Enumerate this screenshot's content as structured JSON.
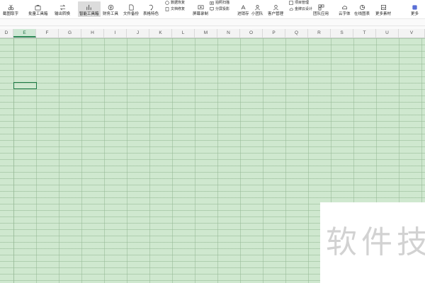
{
  "ribbon": {
    "items": [
      {
        "label": "截图取字",
        "icon": "scissors-icon"
      },
      {
        "label": "批量工具箱",
        "icon": "toolbox-icon"
      },
      {
        "label": "输出转换",
        "icon": "convert-icon"
      },
      {
        "label": "智能工具箱",
        "icon": "smart-toolbox-icon",
        "active": true
      },
      {
        "label": "财务工具",
        "icon": "finance-icon"
      },
      {
        "label": "文件备份",
        "icon": "backup-icon"
      },
      {
        "label": "表格特色",
        "icon": "table-feature-icon"
      },
      {
        "label": "文档修复",
        "icon": "doc-repair-icon"
      },
      {
        "label": "屏幕录制",
        "icon": "screen-record-icon"
      },
      {
        "label": "进销存",
        "icon": "inventory-icon"
      },
      {
        "label": "小团队",
        "icon": "team-icon"
      },
      {
        "label": "客户管理",
        "icon": "customer-icon"
      },
      {
        "label": "团队应用",
        "icon": "team-app-icon"
      },
      {
        "label": "云字体",
        "icon": "cloud-font-icon"
      },
      {
        "label": "在线图表",
        "icon": "online-chart-icon"
      },
      {
        "label": "更多素材",
        "icon": "more-material-icon"
      },
      {
        "label": "更多",
        "icon": "more-icon"
      }
    ],
    "stack1": [
      "数据恢复",
      "文档修复"
    ],
    "stack2": [
      "拍照扫描",
      "分屏投影"
    ],
    "stack3": [
      "项目管理",
      "金牌云设计"
    ]
  },
  "columns": [
    "D",
    "E",
    "F",
    "G",
    "H",
    "I",
    "J",
    "K",
    "L",
    "M",
    "N",
    "O",
    "P",
    "Q",
    "R",
    "S",
    "T",
    "U",
    "V"
  ],
  "active_column": "E",
  "watermark": {
    "text": "软件技"
  },
  "colors": {
    "grid_bg": "#cfe8cf",
    "accent": "#1e7b45"
  }
}
